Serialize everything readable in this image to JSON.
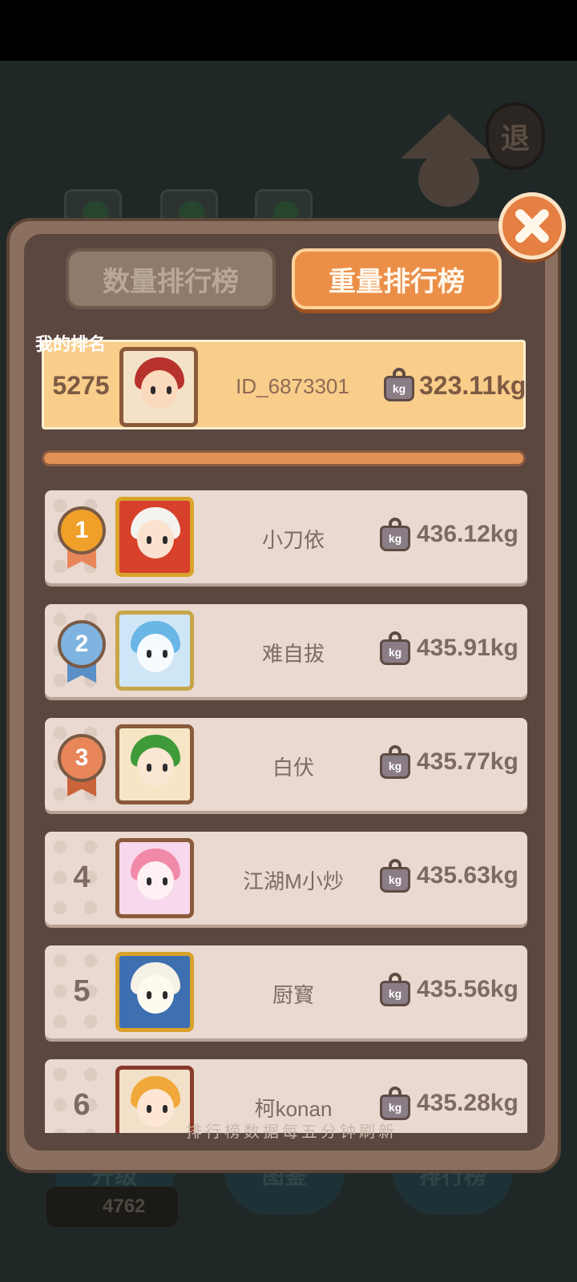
{
  "background": {
    "exit_label": "退",
    "buttons": [
      "升级",
      "图鉴",
      "排行榜"
    ],
    "coins": "4762"
  },
  "tabs": {
    "count": "数量排行榜",
    "weight": "重量排行榜",
    "active": "weight"
  },
  "my_rank": {
    "label": "我的排名",
    "rank": "5275",
    "id": "ID_6873301",
    "weight": "323.11kg"
  },
  "kg_icon_label": "kg",
  "leaderboard": [
    {
      "rank": "1",
      "name": "小刀依",
      "weight": "436.12kg",
      "medal": "gold"
    },
    {
      "rank": "2",
      "name": "难自拔",
      "weight": "435.91kg",
      "medal": "silver"
    },
    {
      "rank": "3",
      "name": "白伏",
      "weight": "435.77kg",
      "medal": "bronze"
    },
    {
      "rank": "4",
      "name": "江湖M小炒",
      "weight": "435.63kg"
    },
    {
      "rank": "5",
      "name": "厨寳",
      "weight": "435.56kg"
    },
    {
      "rank": "6",
      "name": "柯konan",
      "weight": "435.28kg"
    }
  ],
  "footer": "排行榜数据每五分钟刷新",
  "colors": {
    "gold": "#f0a028",
    "silver": "#7fb4e0",
    "bronze": "#e8865a",
    "accent": "#eb8f48"
  }
}
